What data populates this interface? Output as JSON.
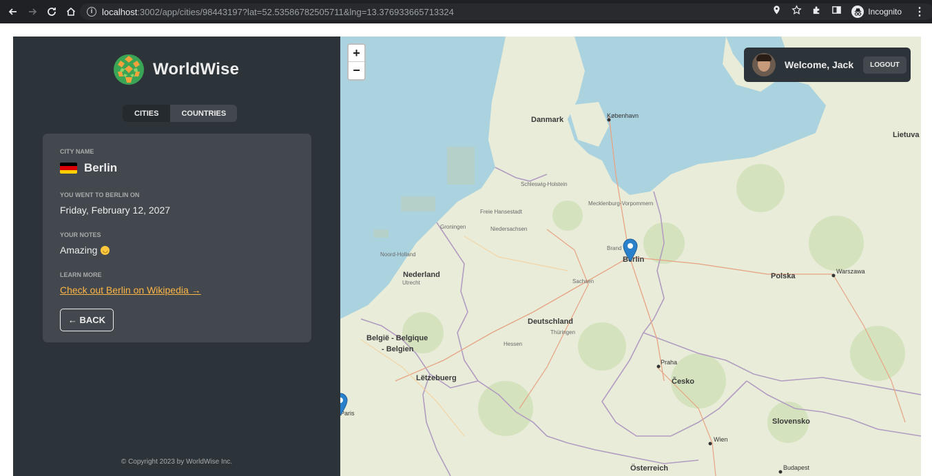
{
  "browser": {
    "url_host": "localhost",
    "url_rest": ":3002/app/cities/98443197?lat=52.53586782505711&lng=13.376933665713324",
    "incognito_label": "Incognito"
  },
  "sidebar": {
    "logo_text": "WorldWise",
    "tabs": [
      {
        "label": "Cities",
        "active": true
      },
      {
        "label": "Countries",
        "active": false
      }
    ],
    "city_card": {
      "city_name_label": "City name",
      "city_name": "Berlin",
      "visit_label": "You went to Berlin on",
      "visit_date": "Friday, February 12, 2027",
      "notes_label": "Your notes",
      "notes": "Amazing",
      "learn_more_label": "Learn more",
      "wiki_link": "Check out Berlin on Wikipedia →",
      "back_button": "← Back"
    },
    "copyright": "© Copyright 2023 by WorldWise Inc."
  },
  "map": {
    "zoom_in": "+",
    "zoom_out": "−",
    "user": {
      "welcome": "Welcome, Jack",
      "logout": "Logout"
    },
    "labels": {
      "danmark": "Danmark",
      "kobenhavn": "København",
      "lietuva": "Lietuva",
      "nederland": "Nederland",
      "deutschland": "Deutschland",
      "belgie1": "België - Belgique",
      "belgie2": "- Belgien",
      "letzebuerg": "Lëtzebuerg",
      "berlin": "Berlin",
      "polska": "Polska",
      "warszawa": "Warszawa",
      "praha": "Praha",
      "cesko": "Česko",
      "slovensko": "Slovensko",
      "wien": "Wien",
      "osterreich": "Österreich",
      "budapest": "Budapest",
      "paris": "Paris",
      "schleswig": "Schleswig-Holstein",
      "mecklenburg": "Mecklenburg-Vorpommern",
      "niedersachsen": "Niedersachsen",
      "freie_hansestadt": "Freie Hansestadt",
      "sachsen": "Sachsen",
      "thuringen": "Thüringen",
      "hessen": "Hessen",
      "brandenburg": "Brand",
      "groningen": "Groningen",
      "noord_holland": "Noord-Holland",
      "utrecht": "Utrecht"
    }
  },
  "colors": {
    "sidebar_bg": "#2d3439",
    "card_bg": "#42484d",
    "accent": "#ffb545",
    "sea": "#aad3df",
    "pin": "#2a81cb"
  }
}
